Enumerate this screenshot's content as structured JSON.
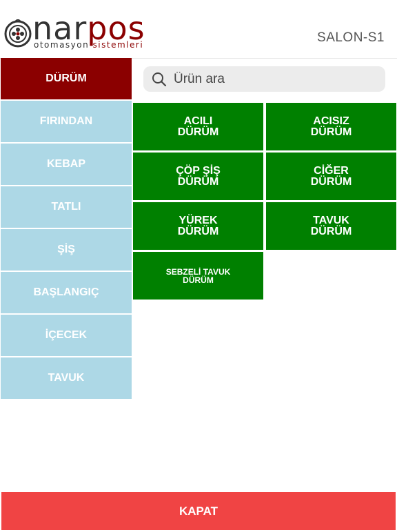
{
  "header": {
    "logo_word_1": "nar",
    "logo_word_2": "pos",
    "logo_sub_1": "otomasyon ",
    "logo_sub_2": "sistemleri",
    "table_name": "SALON-S1"
  },
  "search": {
    "placeholder": "Ürün ara",
    "icon": "search-icon"
  },
  "categories": [
    {
      "label": "DÜRÜM",
      "active": true
    },
    {
      "label": "FIRINDAN"
    },
    {
      "label": "KEBAP"
    },
    {
      "label": "TATLI"
    },
    {
      "label": "ŞİŞ"
    },
    {
      "label": "BAŞLANGIÇ"
    },
    {
      "label": "İÇECEK"
    },
    {
      "label": "TAVUK"
    }
  ],
  "products": [
    {
      "label": "ACILI\nDÜRÜM"
    },
    {
      "label": "ACISIZ\nDÜRÜM"
    },
    {
      "label": "ÇÖP ŞİŞ\nDÜRÜM"
    },
    {
      "label": "CİĞER\nDÜRÜM"
    },
    {
      "label": "YÜREK\nDÜRÜM"
    },
    {
      "label": "TAVUK\nDÜRÜM"
    },
    {
      "label": "SEBZELİ TAVUK\nDÜRÜM"
    }
  ],
  "footer": {
    "close_label": "KAPAT"
  },
  "colors": {
    "active_category": "#8b0000",
    "category": "#add8e6",
    "product": "#008000",
    "close": "#f04444"
  }
}
